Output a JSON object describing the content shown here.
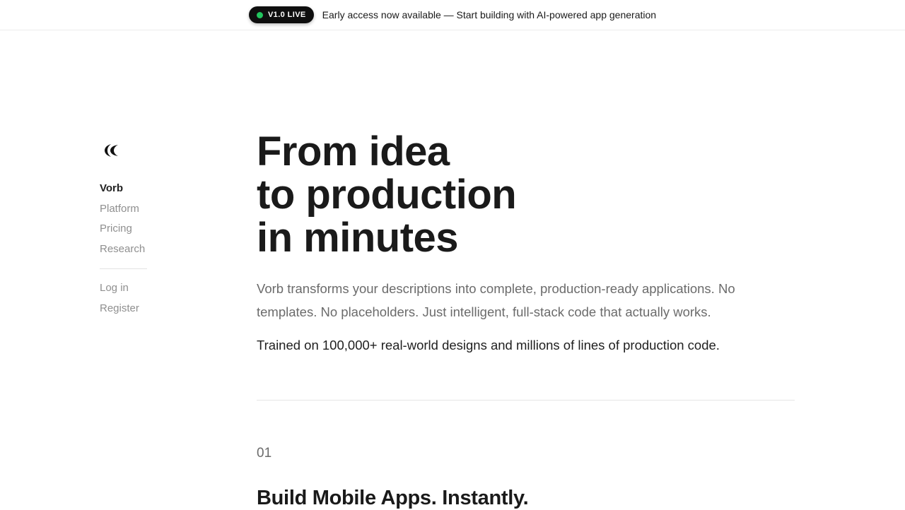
{
  "banner": {
    "badge_label": "V1.0 LIVE",
    "text": "Early access now available — Start building with AI-powered app generation"
  },
  "sidebar": {
    "logo_icon": "vorb-logo-icon",
    "items": [
      {
        "label": "Vorb",
        "active": true
      },
      {
        "label": "Platform"
      },
      {
        "label": "Pricing"
      },
      {
        "label": "Research"
      }
    ],
    "account_items": [
      {
        "label": "Log in"
      },
      {
        "label": "Register"
      }
    ]
  },
  "hero": {
    "headline_lines": [
      "From idea",
      "to production",
      "in minutes"
    ],
    "lead": "Vorb transforms your descriptions into complete, production-ready applications. No templates. No placeholders. Just intelligent, full-stack code that actually works.",
    "trained": "Trained on 100,000+ real-world designs and millions of lines of production code."
  },
  "section": {
    "number": "01",
    "title": "Build Mobile Apps. Instantly."
  },
  "colors": {
    "badge_background": "#0f0f0f",
    "live_dot": "#22c55e",
    "muted_text": "#8f8f8f",
    "primary_text": "#1a1a1a"
  }
}
